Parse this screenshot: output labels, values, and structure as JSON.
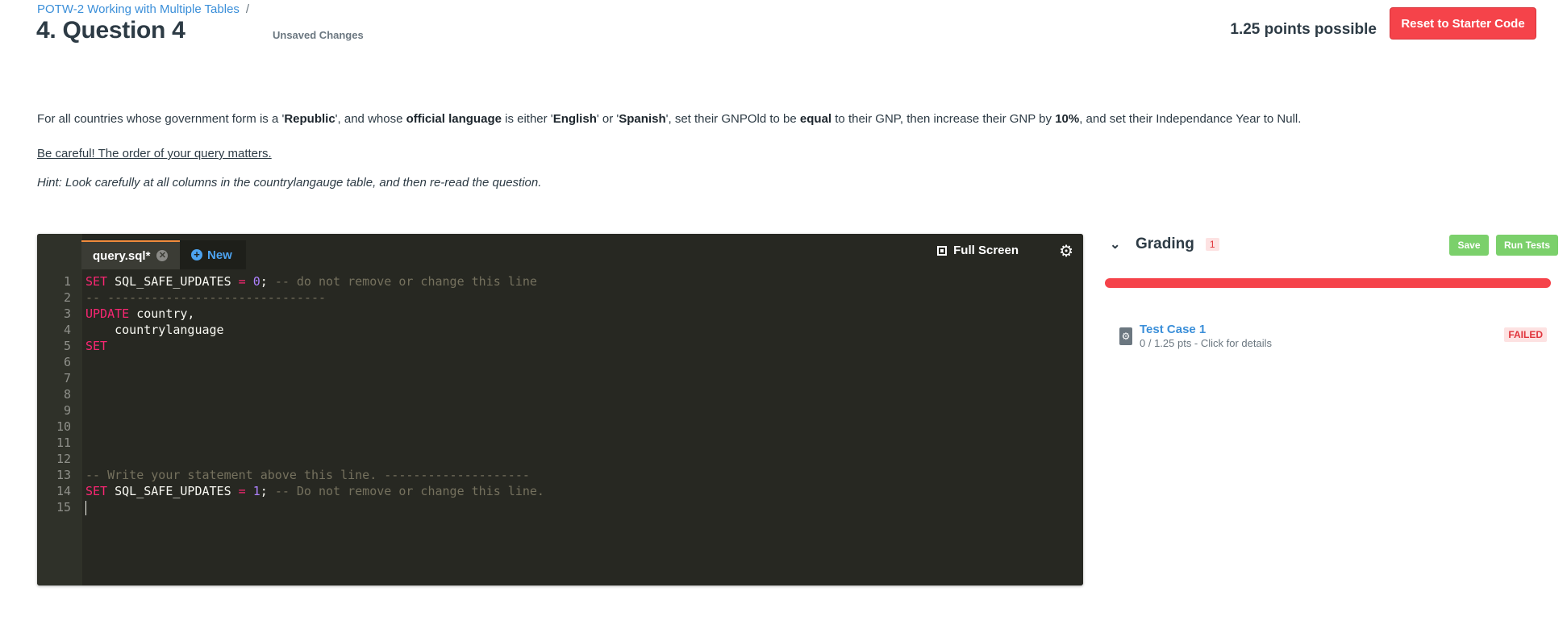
{
  "breadcrumb": {
    "link": "POTW-2 Working with Multiple Tables",
    "separator": "/"
  },
  "title": "4. Question 4",
  "unsaved": "Unsaved Changes",
  "points": "1.25 points possible",
  "reset_button": "Reset to Starter Code",
  "prompt": {
    "p1": "For all countries whose government form is a '",
    "b1": "Republic",
    "p2": "', and whose ",
    "b2": "official language",
    "p3": " is either '",
    "b3": "English",
    "p4": "' or '",
    "b4": "Spanish",
    "p5": "', set their GNPOld to be ",
    "b5": "equal",
    "p6": " to their GNP, then increase their GNP by ",
    "b6": "10%",
    "p7": ", and set their Independance Year to Null."
  },
  "careful": "Be careful! The order of your query matters.",
  "hint": "Hint: Look carefully at all columns in the countrylangauge table, and then re-read the question.",
  "editor": {
    "tab_name": "query.sql*",
    "new_tab": "New",
    "fullscreen": "Full Screen",
    "lines": [
      {
        "n": "1"
      },
      {
        "n": "2"
      },
      {
        "n": "3"
      },
      {
        "n": "4"
      },
      {
        "n": "5"
      },
      {
        "n": "6"
      },
      {
        "n": "7"
      },
      {
        "n": "8"
      },
      {
        "n": "9"
      },
      {
        "n": "10"
      },
      {
        "n": "11"
      },
      {
        "n": "12"
      },
      {
        "n": "13"
      },
      {
        "n": "14"
      },
      {
        "n": "15"
      }
    ],
    "code": {
      "l1_kw": "SET",
      "l1_var": " SQL_SAFE_UPDATES ",
      "l1_eq": "=",
      "l1_sp": " ",
      "l1_num": "0",
      "l1_semi": "; ",
      "l1_cm": "-- do not remove or change this line",
      "l2_cm": "-- ------------------------------",
      "l3_kw": "UPDATE",
      "l3_rest": " country,",
      "l4_rest": "    countrylanguage",
      "l5_kw": "SET",
      "l13_cm": "-- Write your statement above this line. --------------------",
      "l14_kw": "SET",
      "l14_var": " SQL_SAFE_UPDATES ",
      "l14_eq": "=",
      "l14_sp": " ",
      "l14_num": "1",
      "l14_semi": "; ",
      "l14_cm": "-- Do not remove or change this line."
    }
  },
  "grading": {
    "title": "Grading",
    "count": "1",
    "save": "Save",
    "run": "Run Tests",
    "progress_color": "#f5434a",
    "tests": [
      {
        "name": "Test Case 1",
        "detail": "0 / 1.25 pts - Click for details",
        "status": "FAILED"
      }
    ]
  }
}
